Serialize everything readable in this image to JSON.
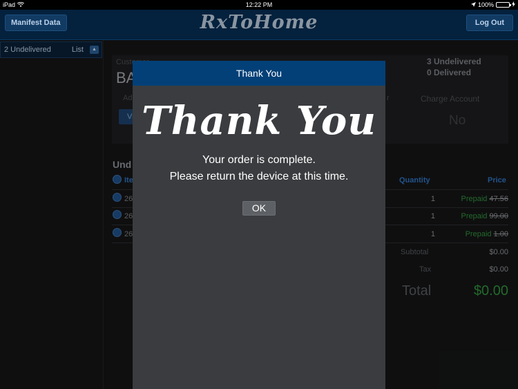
{
  "status_bar": {
    "device": "iPad",
    "time": "12:22 PM",
    "battery": "100%"
  },
  "header": {
    "manifest_button": "Manifest Data",
    "logo": "RxToHome",
    "logout_button": "Log Out"
  },
  "sidebar": {
    "count_label": "2 Undelivered",
    "view_mode": "List"
  },
  "customer": {
    "label": "Customer",
    "name": "BA",
    "undelivered": "3 Undelivered",
    "delivered": "0 Delivered",
    "address_label": "Ad",
    "view_button": "Vi",
    "partial_label": "r",
    "charge_account_label": "Charge Account",
    "charge_account_value": "No"
  },
  "items": {
    "section_title": "Und",
    "columns": {
      "item": "Ite",
      "quantity": "Quantity",
      "price": "Price"
    },
    "rows": [
      {
        "num": "26",
        "quantity": "1",
        "status": "Prepaid",
        "original_price": "47.56"
      },
      {
        "num": "26",
        "quantity": "1",
        "status": "Prepaid",
        "original_price": "99.00"
      },
      {
        "num": "26",
        "quantity": "1",
        "status": "Prepaid",
        "original_price": "1.00"
      }
    ],
    "subtotal_label": "Subtotal",
    "subtotal_value": "$0.00",
    "tax_label": "Tax",
    "tax_value": "$0.00",
    "total_label": "Total",
    "total_value": "$0.00"
  },
  "dialog": {
    "title": "Thank You",
    "script_text": "Thank You",
    "message_line1": "Your order is complete.",
    "message_line2": "Please return the device at this time.",
    "ok_button": "OK"
  }
}
